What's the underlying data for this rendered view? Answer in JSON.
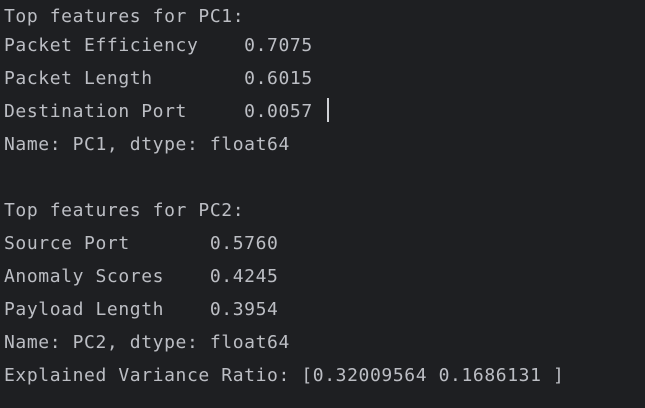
{
  "colors": {
    "background": "#1e1f22",
    "text": "#bcbec4",
    "cursor": "#cfd1d6"
  },
  "console": {
    "lines": [
      "Top features for PC1:",
      "Packet Efficiency    0.7075",
      "Packet Length        0.6015",
      "Destination Port     0.0057",
      "Name: PC1, dtype: float64",
      "",
      "Top features for PC2:",
      "Source Port       0.5760",
      "Anomaly Scores    0.4245",
      "Payload Length    0.3954",
      "Name: PC2, dtype: float64",
      "Explained Variance Ratio: [0.32009564 0.1686131 ]"
    ]
  }
}
